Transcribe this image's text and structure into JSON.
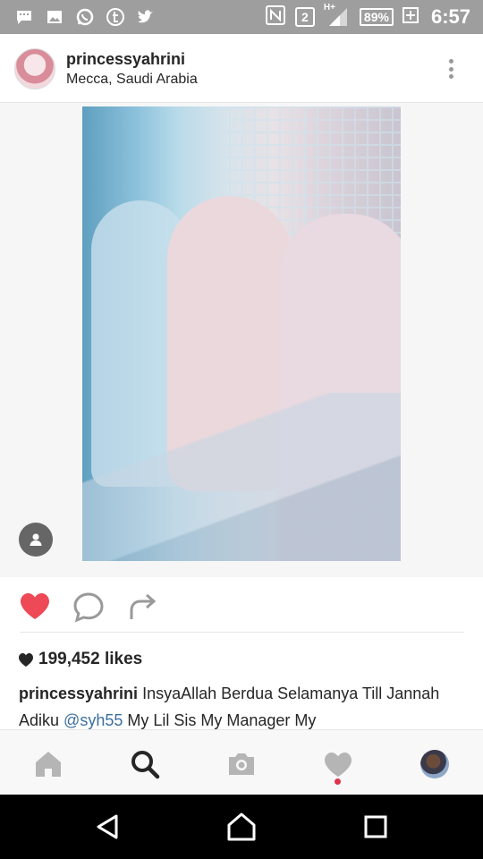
{
  "status_bar": {
    "time": "6:57",
    "battery": "89%",
    "sim": "2",
    "network": "H+",
    "left_icons": [
      "message-icon",
      "image-icon",
      "whatsapp-icon",
      "tumblr-icon",
      "twitter-icon"
    ]
  },
  "post": {
    "username": "princessyahrini",
    "location": "Mecca, Saudi Arabia",
    "likes": "199,452 likes",
    "caption": {
      "user": "princessyahrini",
      "text1": "InsyaAllah Berdua Selamanya Till Jannah Adiku",
      "mention": "@syh55",
      "text2": "My Lil Sis My Manager My"
    }
  },
  "colors": {
    "status_bar_bg": "#9e9e9e",
    "like_red": "#ed4956",
    "mention_blue": "#3b6fa0",
    "tab_icon_gray": "#b5b5b5",
    "notification_dot": "#e0334a"
  },
  "tabbar": {
    "items": [
      "home-icon",
      "search-icon",
      "camera-icon",
      "heart-icon",
      "profile-avatar"
    ],
    "active": "search-icon"
  },
  "navbar": {
    "items": [
      "back-icon",
      "home-icon",
      "recents-icon"
    ]
  }
}
